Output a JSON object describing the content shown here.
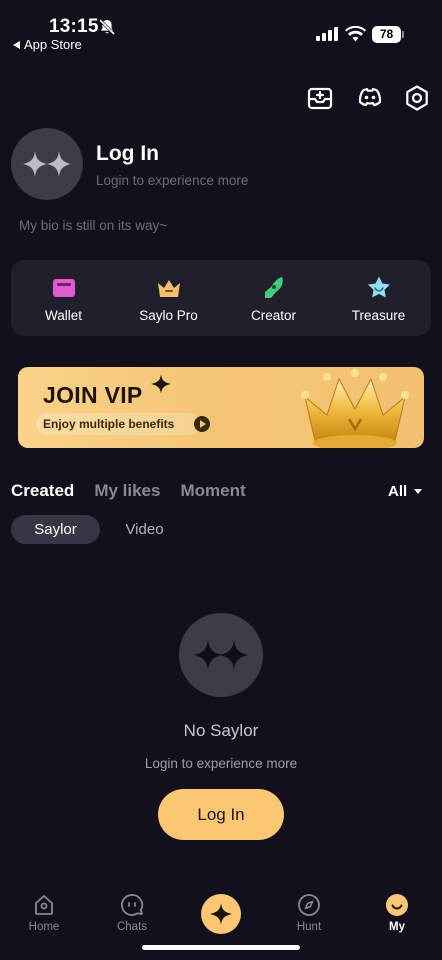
{
  "status_bar": {
    "time": "13:15",
    "back_label": "App Store",
    "battery": "78"
  },
  "profile": {
    "title": "Log In",
    "subtitle": "Login to experience more",
    "bio": "My bio is still on its way~"
  },
  "features": [
    {
      "label": "Wallet",
      "icon": "wallet-icon",
      "color": "#e05ad0"
    },
    {
      "label": "Saylo Pro",
      "icon": "crown-icon",
      "color": "#f5be6a"
    },
    {
      "label": "Creator",
      "icon": "pen-icon",
      "color": "#3ecf7e"
    },
    {
      "label": "Treasure",
      "icon": "star-icon",
      "color": "#8fe0f2"
    }
  ],
  "vip_banner": {
    "title": "JOIN VIP",
    "subtitle": "Enjoy multiple benefits"
  },
  "tabs": {
    "items": [
      "Created",
      "My likes",
      "Moment"
    ],
    "active": "Created",
    "filter": "All"
  },
  "chips": {
    "items": [
      "Saylor",
      "Video"
    ],
    "active": "Saylor"
  },
  "empty_state": {
    "title": "No Saylor",
    "subtitle": "Login to experience more",
    "button": "Log In"
  },
  "bottom_nav": {
    "items": [
      "Home",
      "Chats",
      "Hunt",
      "My"
    ],
    "active": "My"
  },
  "colors": {
    "background": "#12101c",
    "accent": "#fcc773",
    "card": "#211f2c"
  }
}
